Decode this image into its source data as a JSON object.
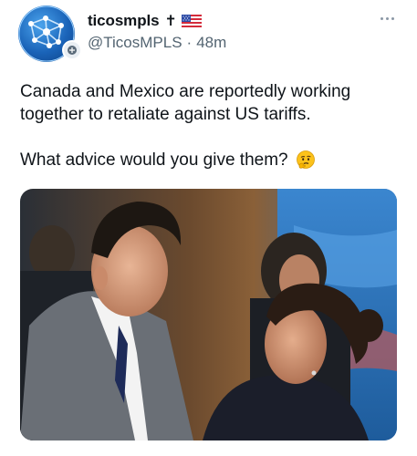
{
  "tweet": {
    "author": {
      "display_name": "ticosmpls",
      "name_suffix": "✝",
      "flag_icon": "us-flag-icon",
      "handle": "@TicosMPLS",
      "separator": "·",
      "timestamp": "48m",
      "avatar_icon": "globe-network-icon"
    },
    "text": {
      "line1": "Canada and Mexico are reportedly working together to retaliate against US tariffs.",
      "line2": "What advice would you give them?",
      "emoji": "thinking-face-emoji"
    },
    "more_icon": "more-options-icon",
    "media": {
      "type": "photo"
    }
  },
  "colors": {
    "text_primary": "#0f1419",
    "text_secondary": "#536471",
    "background": "#ffffff"
  }
}
